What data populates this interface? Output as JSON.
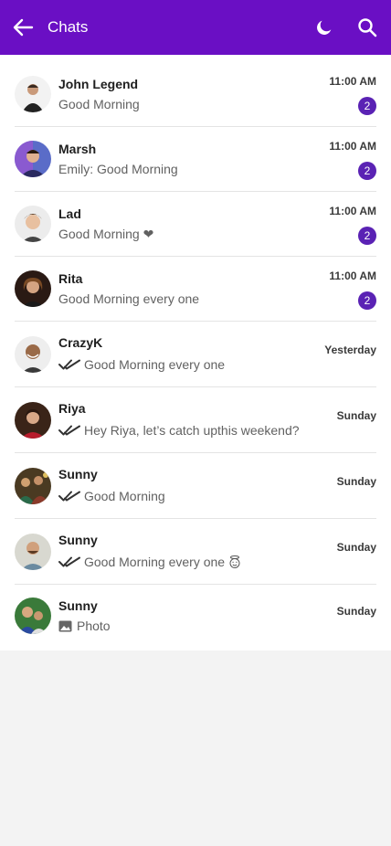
{
  "appbar": {
    "title": "Chats",
    "bg_color": "#6a0fc4",
    "icons": [
      "arrow-back-icon",
      "moon-icon",
      "search-icon"
    ]
  },
  "accent": {
    "badge": "#5a22b4"
  },
  "chats": [
    {
      "name": "John Legend",
      "message": "Good Morning",
      "time": "11:00 AM",
      "unread": "2"
    },
    {
      "name": "Marsh",
      "message": "Emily: Good Morning",
      "time": "11:00 AM",
      "unread": "2"
    },
    {
      "name": "Lad",
      "message": "Good Morning ❤",
      "time": "11:00 AM",
      "unread": "2"
    },
    {
      "name": "Rita",
      "message": "Good Morning every one",
      "time": "11:00 AM",
      "unread": "2"
    },
    {
      "name": "CrazyK",
      "message": "Good Morning every one",
      "time": "Yesterday",
      "status": "read-double-tick"
    },
    {
      "name": "Riya",
      "message": "Hey Riya, let’s catch upthis weekend?",
      "time": "Sunday",
      "status": "read-double-tick"
    },
    {
      "name": "Sunny",
      "message": "Good Morning",
      "time": "Sunday",
      "status": "read-double-tick"
    },
    {
      "name": "Sunny",
      "message": "Good Morning every one",
      "time": "Sunday",
      "status": "read-double-tick",
      "emoji": "smiling-face-with-halo"
    },
    {
      "name": "Sunny",
      "message": "Photo",
      "time": "Sunday",
      "attachment": "photo-icon"
    }
  ]
}
